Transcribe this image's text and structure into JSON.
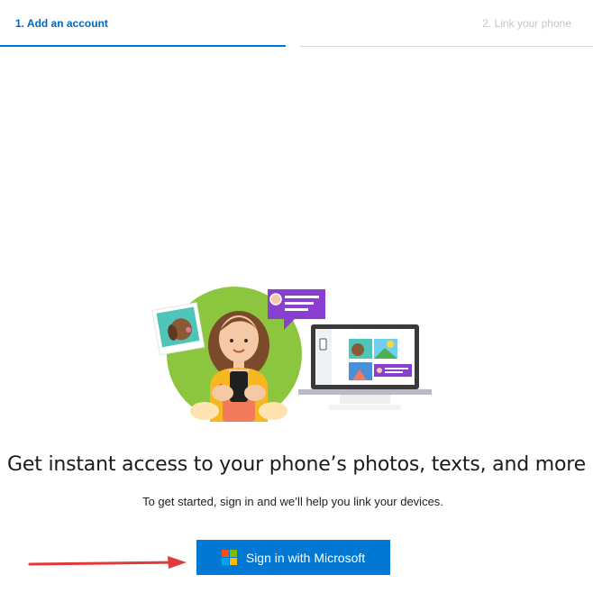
{
  "steps": [
    {
      "label": "1. Add an account",
      "state": "active"
    },
    {
      "label": "2. Link your phone",
      "state": "inactive"
    }
  ],
  "main": {
    "headline": "Get instant access to your phone’s photos, texts, and more",
    "subtext": "To get started, sign in and we’ll help you link your devices."
  },
  "signin_button": {
    "label": "Sign in with Microsoft",
    "icon": "microsoft-logo-icon",
    "logo_colors": [
      "#f25022",
      "#7fba00",
      "#00a4ef",
      "#ffb900"
    ]
  },
  "colors": {
    "accent": "#0078d4",
    "active_step_text": "#0067c0",
    "inactive_step_text": "#c4c4c4",
    "annotation_arrow": "#e03a3a"
  }
}
